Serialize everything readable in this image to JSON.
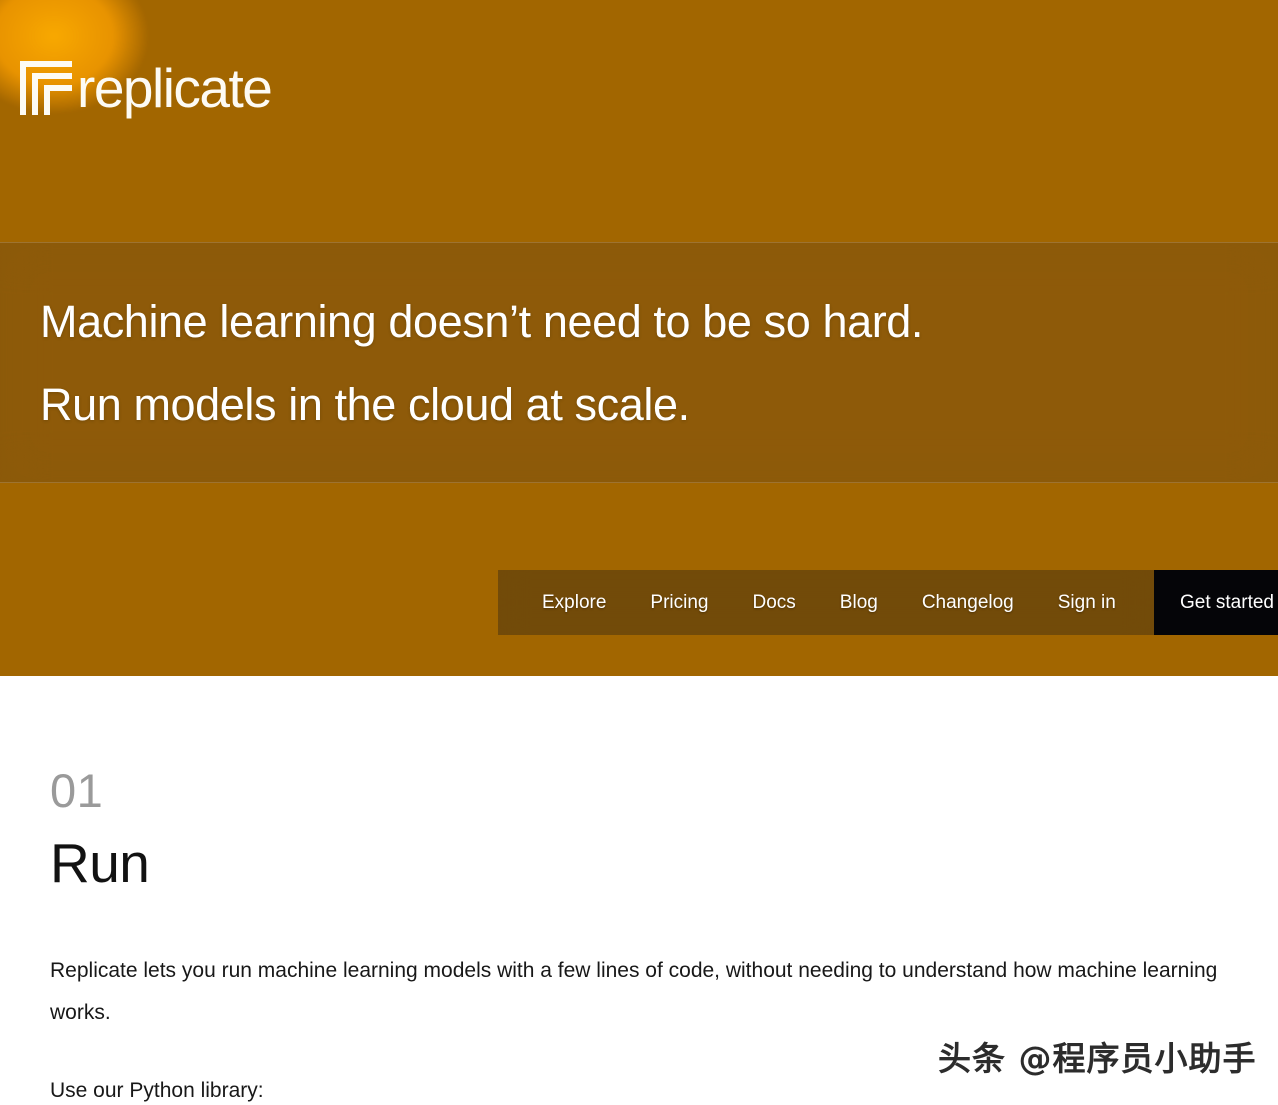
{
  "brand": {
    "name": "replicate",
    "logo_icon": "replicate-nested-r-mark",
    "logo_color": "#fdfbf4"
  },
  "hero": {
    "headline_line1": "Machine learning doesn’t need to be so hard.",
    "headline_line2": "Run models in the cloud at scale.",
    "text_color": "#ffffff",
    "background_image": "colorful-pebbles-photo"
  },
  "nav": {
    "items": [
      {
        "label": "Explore"
      },
      {
        "label": "Pricing"
      },
      {
        "label": "Docs"
      },
      {
        "label": "Blog"
      },
      {
        "label": "Changelog"
      },
      {
        "label": "Sign in"
      }
    ],
    "cta": {
      "label": "Get started",
      "background": "#050508",
      "text_color": "#ffffff"
    },
    "bar_background": "rgba(22,22,26,0.34)"
  },
  "section": {
    "number": "01",
    "number_color": "#9a9a9a",
    "title": "Run",
    "title_color": "#121212",
    "paragraph": "Replicate lets you run machine learning models with a few lines of code, without needing to understand how machine learning works.",
    "sub_heading": "Use our Python library:"
  },
  "watermark": {
    "text": "头条 @程序员小助手"
  }
}
